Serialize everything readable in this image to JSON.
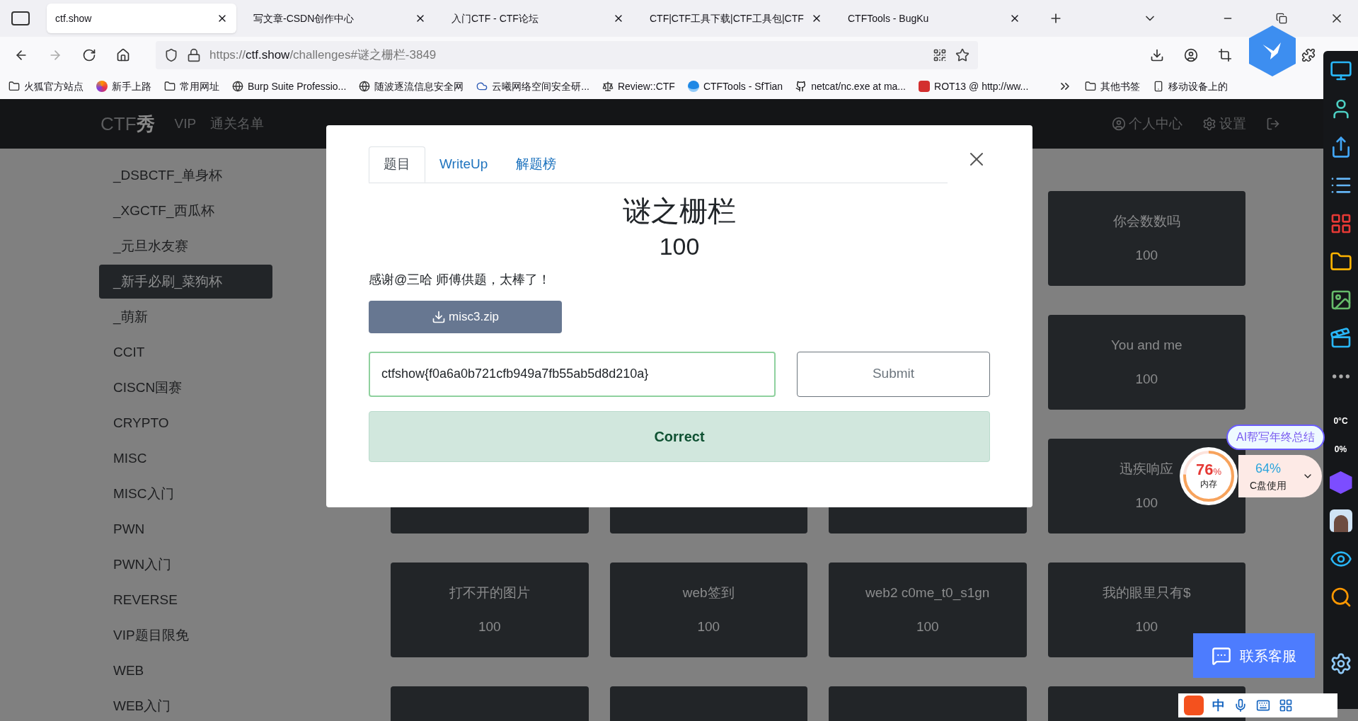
{
  "browser": {
    "tabs": [
      {
        "title": "ctf.show",
        "selected": true
      },
      {
        "title": "写文章-CSDN创作中心",
        "selected": false
      },
      {
        "title": "入门CTF - CTF论坛",
        "selected": false
      },
      {
        "title": "CTF|CTF工具下载|CTF工具包|CTF",
        "selected": false
      },
      {
        "title": "CTFTools - BugKu",
        "selected": false
      }
    ],
    "url": {
      "scheme": "https://",
      "host": "ctf.show",
      "path": "/challenges#谜之栅栏-3849"
    },
    "bookmarks": [
      {
        "label": "火狐官方站点",
        "kind": "folder"
      },
      {
        "label": "新手上路",
        "kind": "firefox"
      },
      {
        "label": "常用网址",
        "kind": "folder"
      },
      {
        "label": "Burp Suite Professio...",
        "kind": "globe"
      },
      {
        "label": "随波逐流信息安全网",
        "kind": "globe"
      },
      {
        "label": "云曦网络空间安全研...",
        "kind": "cloud"
      },
      {
        "label": "Review::CTF",
        "kind": "scale"
      },
      {
        "label": "CTFTools - SfTian",
        "kind": "wave"
      },
      {
        "label": "netcat/nc.exe at ma...",
        "kind": "github"
      },
      {
        "label": "ROT13 @ http://ww...",
        "kind": "rot"
      }
    ],
    "other_bookmarks": [
      {
        "label": "其他书签",
        "kind": "folder"
      },
      {
        "label": "移动设备上的",
        "kind": "mobile"
      }
    ]
  },
  "site_nav": {
    "logo": "CTF",
    "logo_mark": "秀",
    "items": [
      "VIP",
      "通关名单"
    ],
    "user_links": [
      {
        "label": "个人中心",
        "kind": "user"
      },
      {
        "label": "设置",
        "kind": "settings"
      }
    ]
  },
  "sidebar": {
    "items": [
      {
        "label": "_DSBCTF_单身杯",
        "selected": false
      },
      {
        "label": "_XGCTF_西瓜杯",
        "selected": false
      },
      {
        "label": "_元旦水友赛",
        "selected": false
      },
      {
        "label": "_新手必刷_菜狗杯",
        "selected": true
      },
      {
        "label": "_萌新",
        "selected": false
      },
      {
        "label": "CCIT",
        "selected": false
      },
      {
        "label": "CISCN国赛",
        "selected": false
      },
      {
        "label": "CRYPTO",
        "selected": false
      },
      {
        "label": "MISC",
        "selected": false
      },
      {
        "label": "MISC入门",
        "selected": false
      },
      {
        "label": "PWN",
        "selected": false
      },
      {
        "label": "PWN入门",
        "selected": false
      },
      {
        "label": "REVERSE",
        "selected": false
      },
      {
        "label": "VIP题目限免",
        "selected": false
      },
      {
        "label": "WEB",
        "selected": false
      },
      {
        "label": "WEB入门",
        "selected": false
      }
    ]
  },
  "challenges": [
    {
      "kind": "challenge",
      "title": "你会数数吗",
      "score": "100"
    },
    {
      "kind": "challenge",
      "title": "You and me",
      "score": "100"
    },
    {
      "kind": "covered"
    },
    {
      "kind": "covered"
    },
    {
      "kind": "covered"
    },
    {
      "kind": "challenge",
      "title": "迅疾响应",
      "score": "100"
    },
    {
      "kind": "challenge",
      "title": "打不开的图片",
      "score": "100"
    },
    {
      "kind": "challenge",
      "title": "web签到",
      "score": "100"
    },
    {
      "kind": "challenge",
      "title": "web2 c0me_t0_s1gn",
      "score": "100"
    },
    {
      "kind": "challenge",
      "title": "我的眼里只有$",
      "score": "100"
    },
    {
      "kind": "covered"
    },
    {
      "kind": "covered"
    },
    {
      "kind": "covered"
    },
    {
      "kind": "covered"
    }
  ],
  "modal": {
    "tabs": [
      {
        "label": "题目",
        "selected": true
      },
      {
        "label": "WriteUp",
        "selected": false
      },
      {
        "label": "解题榜",
        "selected": false
      }
    ],
    "title": "谜之栅栏",
    "score": "100",
    "description": "感谢@三哈 师傅供题，太棒了！",
    "download": "misc3.zip",
    "flag_input": {
      "value": "ctfshow{f0a6a0b721cfb949a7fb55ab5d8d210a}"
    },
    "submit": "Submit",
    "result": "Correct"
  },
  "widgets": {
    "ai_badge": "AI帮写年终总结",
    "memory": {
      "value": "76",
      "unit": "%",
      "label": "内存",
      "level": 0.76
    },
    "disk": {
      "value": "64%",
      "label": "C盘使用"
    },
    "contact": "联系客服",
    "ime": "中"
  },
  "system_sidebar": {
    "temperature": "0°C",
    "usage": "0%"
  }
}
